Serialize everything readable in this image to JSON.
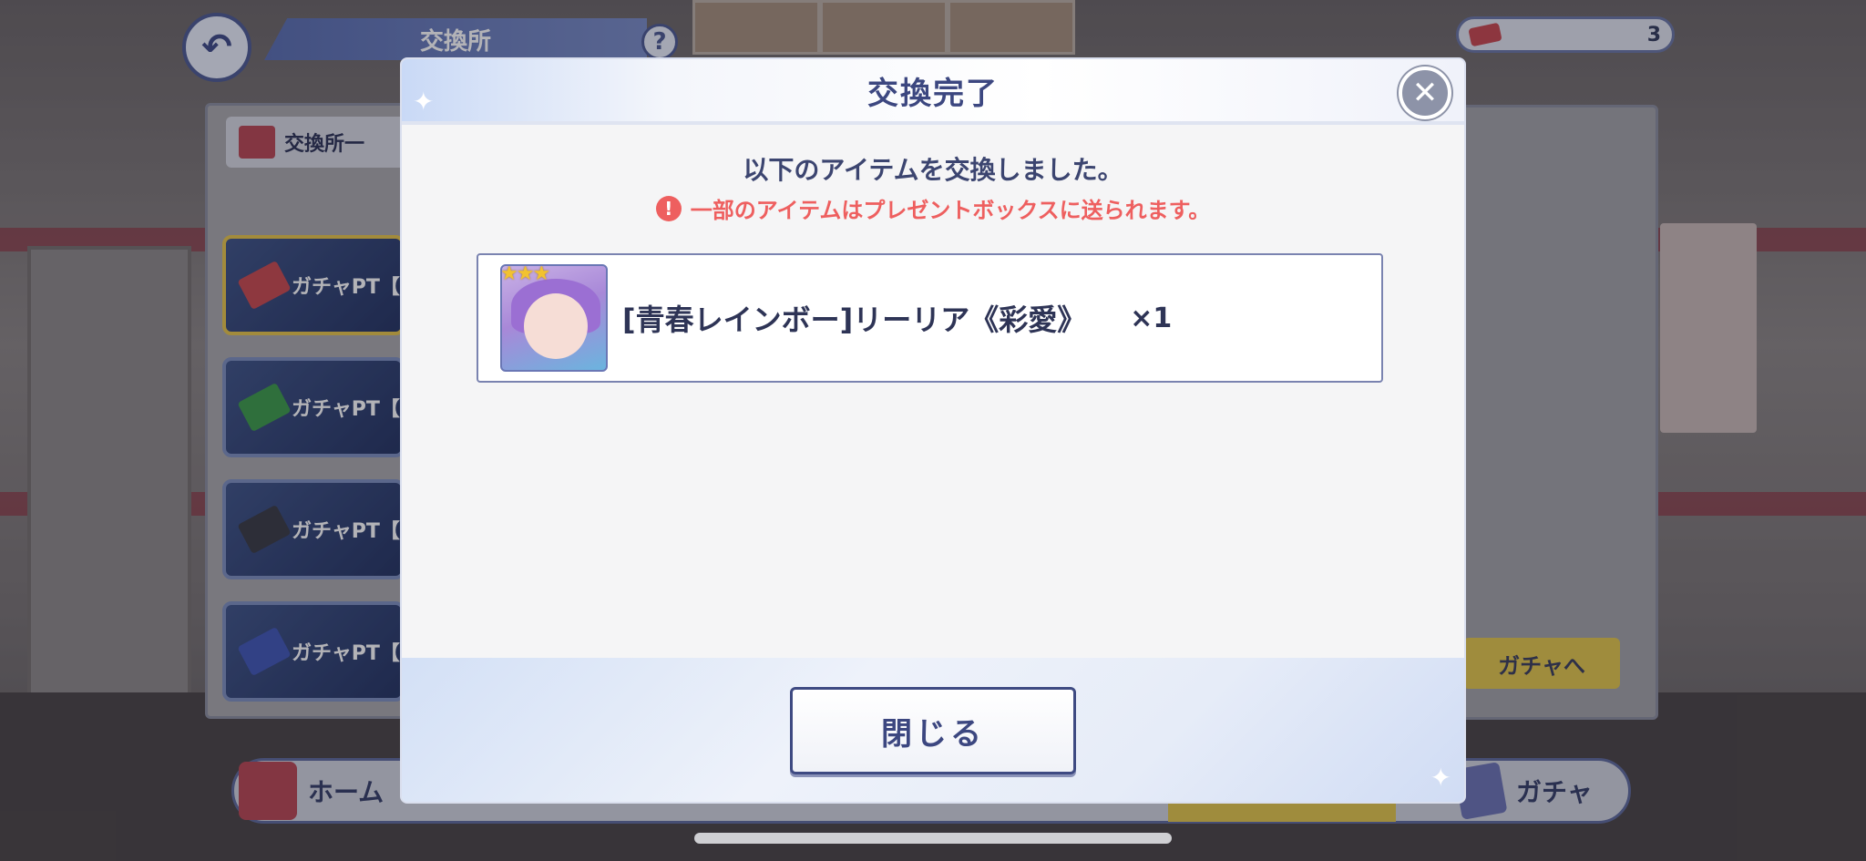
{
  "header": {
    "back_icon": "back-arrow-icon",
    "title": "交換所",
    "help_label": "?"
  },
  "currency": {
    "icon": "gacha-ticket-icon",
    "value": "3"
  },
  "exchange_list": {
    "header_label": "交換所一",
    "items": [
      {
        "label": "ガチャPT【茶",
        "ticket_color": "#c94a4f",
        "selected": true
      },
      {
        "label": "ガチャPT【深緑",
        "ticket_color": "#3d9b4a",
        "selected": false
      },
      {
        "label": "ガチャPT【黒",
        "ticket_color": "#3a3c44",
        "selected": false
      },
      {
        "label": "ガチャPT【紺",
        "ticket_color": "#4157b6",
        "selected": false
      }
    ]
  },
  "side_button": {
    "label": "ガチャへ"
  },
  "bottom_nav": {
    "home_label": "ホーム",
    "gacha_label": "ガチャ"
  },
  "modal": {
    "title": "交換完了",
    "message": "以下のアイテムを交換しました。",
    "warning": "一部のアイテムはプレゼントボックスに送られます。",
    "warning_icon": "exclamation-icon",
    "close_icon": "close-x-icon",
    "item": {
      "rarity_stars": "★★★",
      "name": "[青春レインボー]リーリア《彩愛》",
      "quantity": "×1"
    },
    "close_button_label": "閉じる"
  },
  "colors": {
    "accent": "#3c4780",
    "warning": "#ee5f5f",
    "gold": "#e2c64c"
  }
}
